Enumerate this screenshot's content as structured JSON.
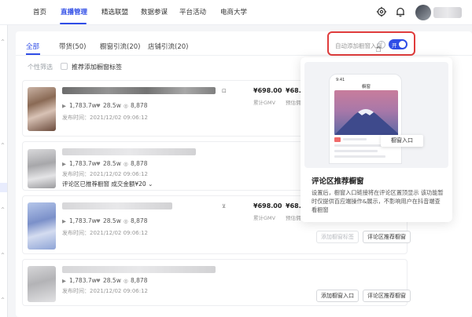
{
  "nav": {
    "items": [
      {
        "label": "首页"
      },
      {
        "label": "直播管理"
      },
      {
        "label": "精选联盟"
      },
      {
        "label": "数据参谋"
      },
      {
        "label": "平台活动"
      },
      {
        "label": "电商大学"
      }
    ],
    "icons": [
      "gear-icon",
      "bell-icon",
      "avatar"
    ]
  },
  "tabs": [
    {
      "label": "全部"
    },
    {
      "label": "带货(50)"
    },
    {
      "label": "橱窗引流(20)"
    },
    {
      "label": "店铺引流(20)"
    }
  ],
  "filter": {
    "label": "个性筛选",
    "checkbox_label": "推荐添加橱窗标签"
  },
  "auto_add": {
    "label": "自动添加橱窗入口",
    "toggle_text": "开",
    "toggle_on": true
  },
  "cards": [
    {
      "views": "1,783.7w",
      "likes": "28.5w",
      "comments": "8,878",
      "publish_time": "发布时间：2021/12/02 09:06:12",
      "price": "¥698.00",
      "price_label": "累计GMV",
      "price2": "¥68.0",
      "price2_label": "预估佣"
    },
    {
      "views": "1,783.7w",
      "likes": "28.5w",
      "comments": "8,878",
      "publish_time": "发布时间：2021/12/02 09:06:12",
      "comment_status": "评论区已推荐橱窗 成交金额¥20"
    },
    {
      "views": "1,783.7w",
      "likes": "28.5w",
      "comments": "8,878",
      "publish_time": "发布时间：2021/12/02 09:06:12",
      "price": "¥698.00",
      "price_label": "累计GMV",
      "price2": "¥68.0",
      "price2_label": "预估佣",
      "btn_add": "添加橱窗标签",
      "btn_recommend": "评论区推荐橱窗"
    },
    {
      "views": "1,783.7w",
      "likes": "28.5w",
      "comments": "8,878",
      "publish_time": "发布时间：2021/12/02 09:06:12",
      "btn_add": "添加橱窗入口",
      "btn_recommend": "评论区推荐橱窗"
    }
  ],
  "popover": {
    "phone_time": "9:41",
    "phone_title": "橱窗",
    "window_button": "橱窗入口",
    "title": "评论区推荐橱窗",
    "description": "设置后，橱窗入口链接将在评论区置顶显示 该功能暂时仅提供百应端操作&展示，不影响用户在抖音端查看橱窗"
  },
  "colors": {
    "accent": "#2f4de6",
    "highlight": "#e03c3c"
  }
}
